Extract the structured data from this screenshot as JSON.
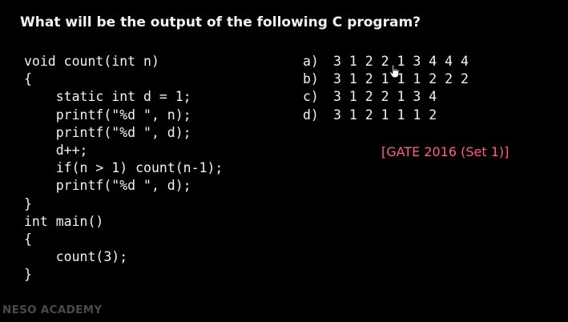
{
  "question": "What will be the output of the following C program?",
  "code_lines": [
    "void count(int n)",
    "{",
    "    static int d = 1;",
    "    printf(\"%d \", n);",
    "    printf(\"%d \", d);",
    "    d++;",
    "    if(n > 1) count(n-1);",
    "    printf(\"%d \", d);",
    "}",
    "int main()",
    "{",
    "    count(3);",
    "}"
  ],
  "options": [
    {
      "letter": "a)",
      "text": "3 1 2 2 1 3 4 4 4"
    },
    {
      "letter": "b)",
      "text": "3 1 2 1 1 1 2 2 2"
    },
    {
      "letter": "c)",
      "text": "3 1 2 2 1 3 4"
    },
    {
      "letter": "d)",
      "text": "3 1 2 1 1 1 2"
    }
  ],
  "source_tag": "[GATE 2016 (Set 1)]",
  "watermark": "NESO ACADEMY",
  "colors": {
    "background": "#000000",
    "text": "#f2f2f2",
    "source_tag": "#ff5c8a",
    "watermark": "#4a4a4a"
  },
  "icons": {
    "cursor": "hand-pointer-icon"
  }
}
